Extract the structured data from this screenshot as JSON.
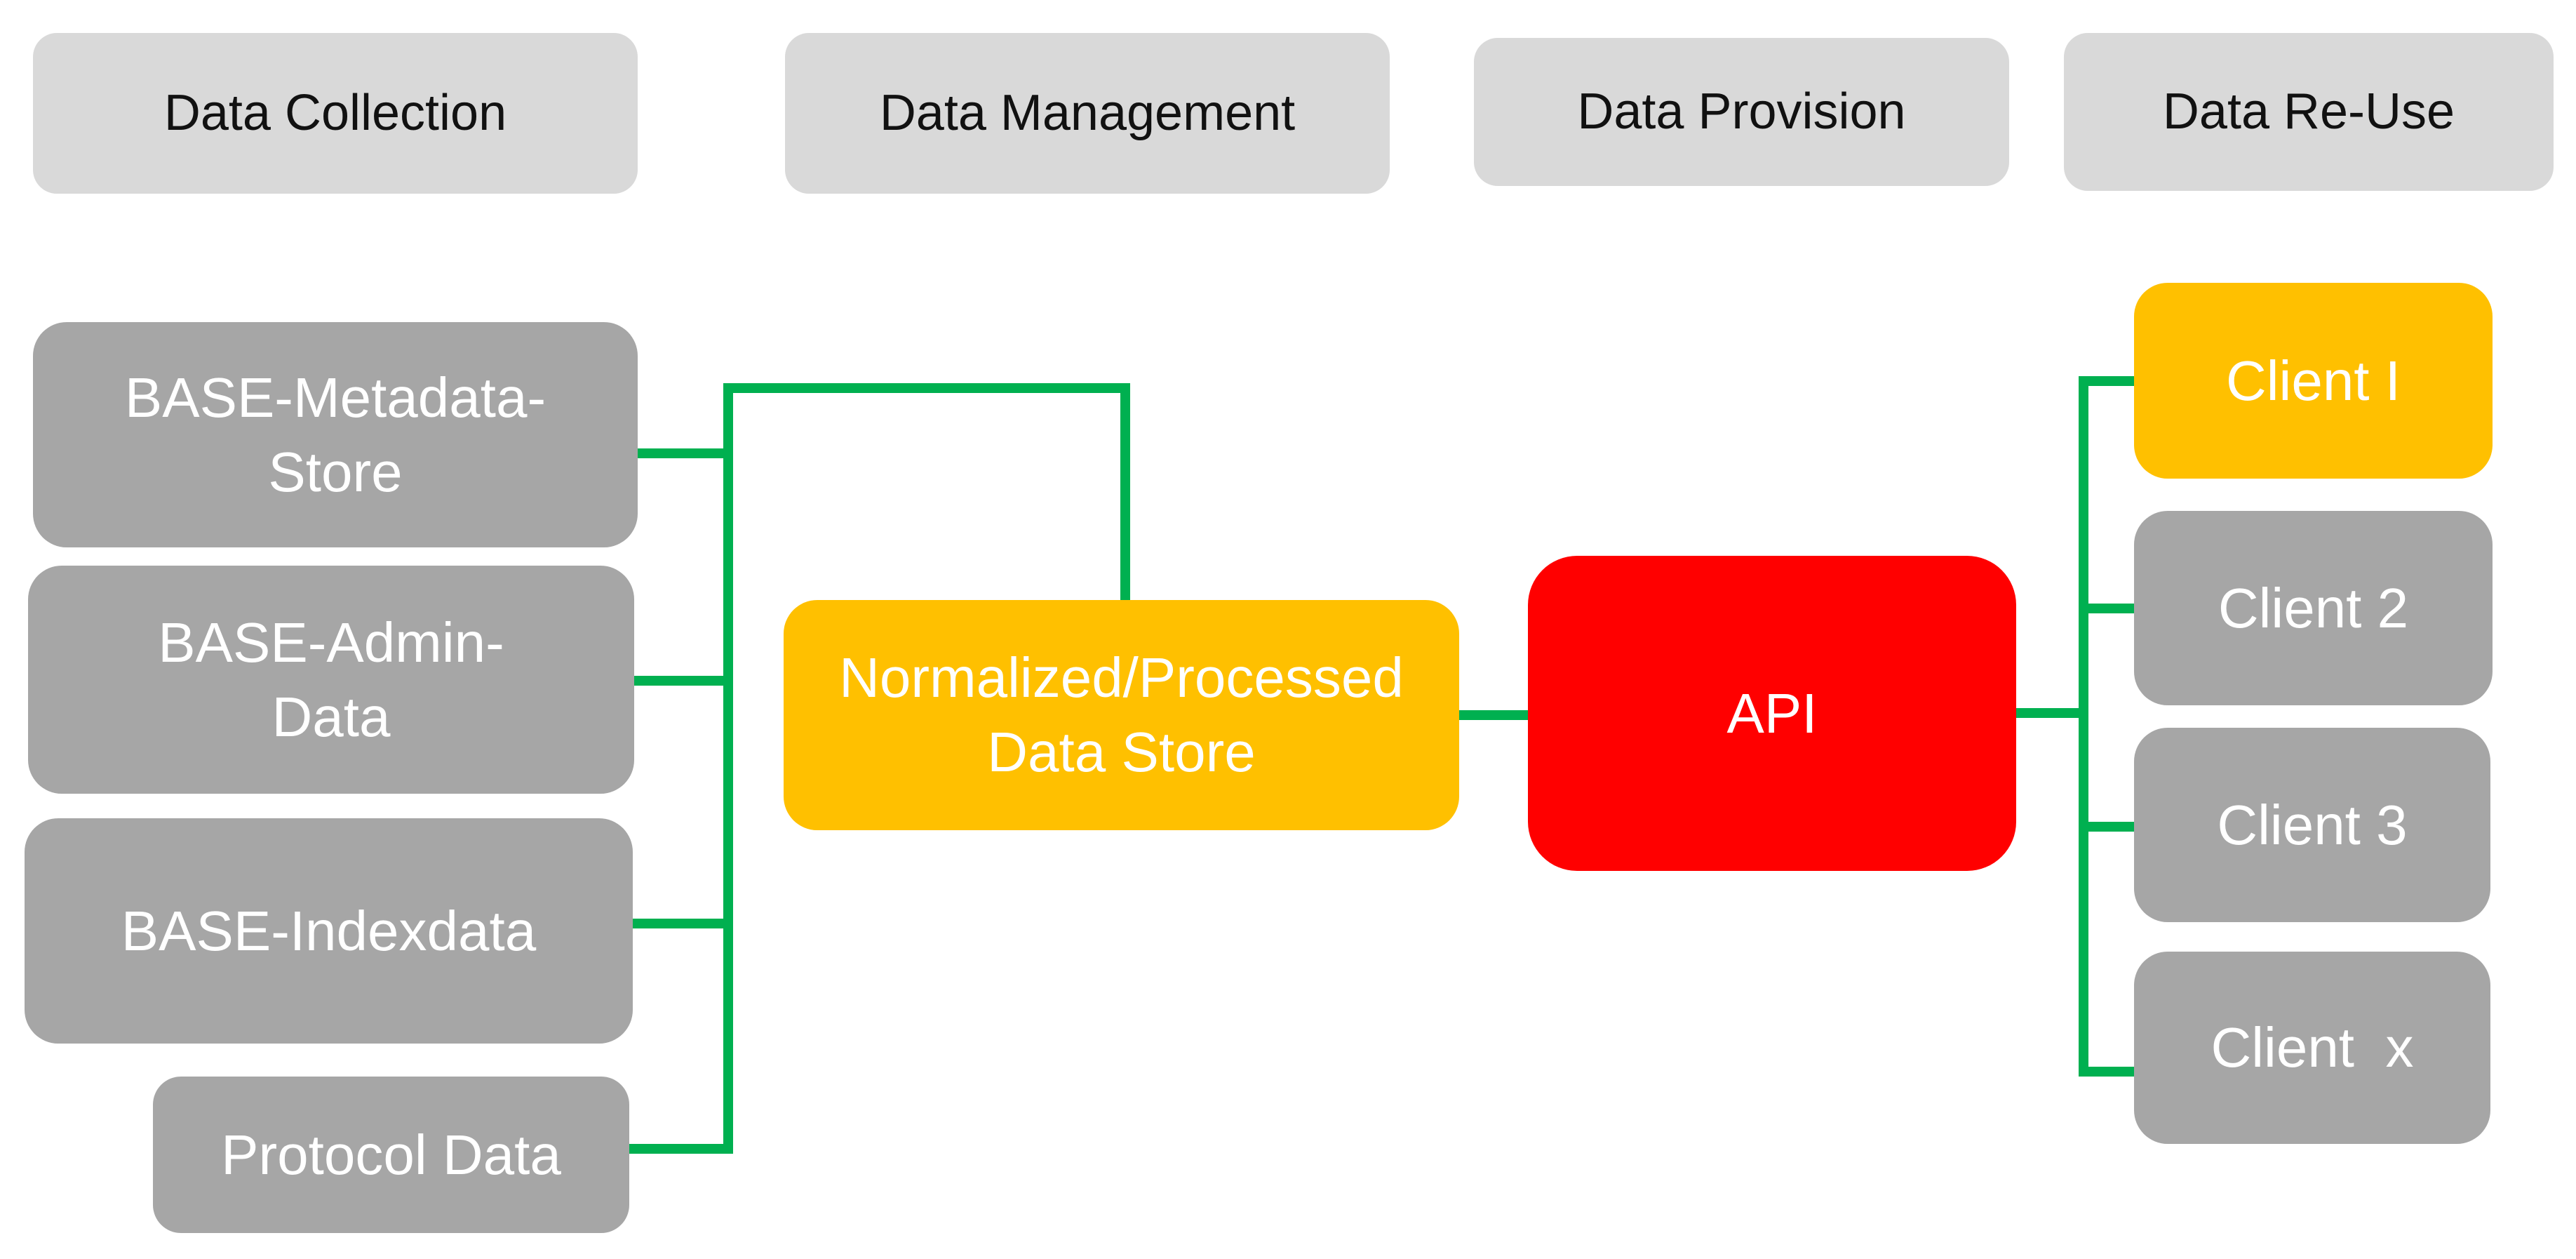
{
  "phases": [
    {
      "label": "Data Collection"
    },
    {
      "label": "Data Management"
    },
    {
      "label": "Data Provision"
    },
    {
      "label": "Data Re-Use"
    }
  ],
  "sources": [
    {
      "label": "BASE-Metadata-\nStore"
    },
    {
      "label": "BASE-Admin-\nData"
    },
    {
      "label": "BASE-Indexdata"
    },
    {
      "label": "Protocol Data"
    }
  ],
  "store": {
    "label": "Normalized/Processed\nData Store"
  },
  "api": {
    "label": "API"
  },
  "clients": [
    {
      "label": "Client I"
    },
    {
      "label": "Client 2"
    },
    {
      "label": "Client 3"
    },
    {
      "label": "Client  x"
    }
  ],
  "colors": {
    "phase_bg": "#d9d9d9",
    "source_bg": "#a6a6a6",
    "highlight": "#ffc000",
    "api": "#ff0000",
    "connector": "#00b050"
  }
}
